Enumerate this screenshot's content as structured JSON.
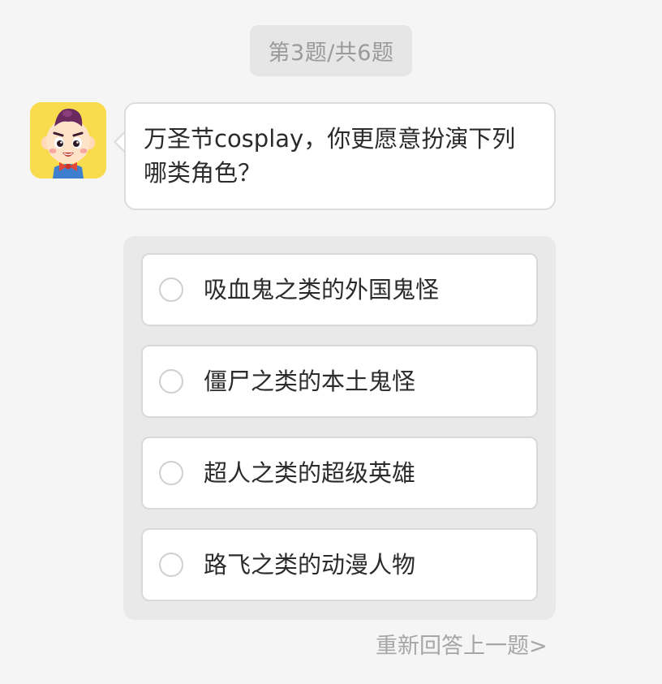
{
  "progress": {
    "text": "第3题/共6题"
  },
  "avatar": {
    "icon": "cartoon-boy-avatar-icon",
    "background_color": "#f8dc4e"
  },
  "question": {
    "text_line1": "万圣节cosplay，你更愿意扮演下列",
    "text_line2": "哪类角色？"
  },
  "options": [
    {
      "label": "吸血鬼之类的外国鬼怪"
    },
    {
      "label": "僵尸之类的本土鬼怪"
    },
    {
      "label": "超人之类的超级英雄"
    },
    {
      "label": "路飞之类的动漫人物"
    }
  ],
  "footer": {
    "redo_label": "重新回答上一题>"
  }
}
